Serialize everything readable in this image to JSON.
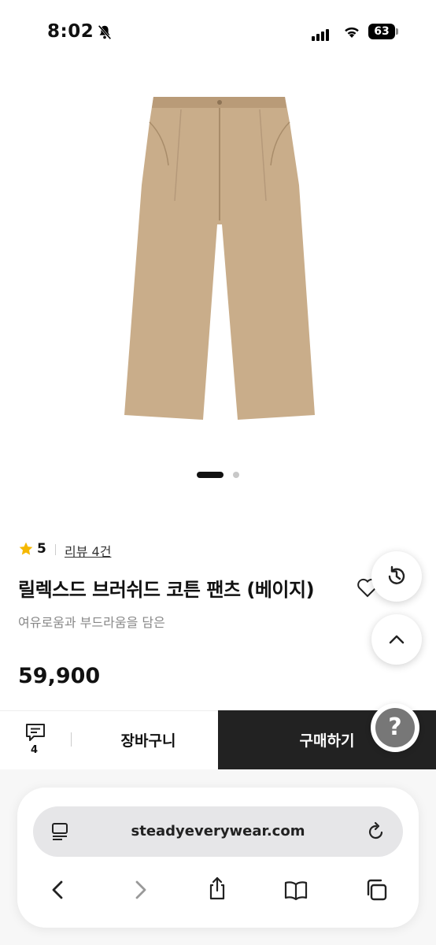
{
  "status_bar": {
    "time": "8:02",
    "battery": "63"
  },
  "product": {
    "rating": "5",
    "review_link": "리뷰 4건",
    "title": "릴렉스드 브러쉬드 코튼 팬츠 (베이지)",
    "subtitle": "여유로움과 부드라움을 담은",
    "price": "59,900",
    "image_color": "#c9ad8a"
  },
  "buy_bar": {
    "chat_count": "4",
    "cart_label": "장바구니",
    "buy_label": "구매하기"
  },
  "browser": {
    "url": "steadyeverywear.com"
  },
  "help_button": {
    "label": "?"
  },
  "icons": [
    "bell-off-icon",
    "wifi-icon",
    "star-icon",
    "heart-icon",
    "history-icon",
    "chevron-up-icon",
    "chat-icon",
    "reader-icon",
    "reload-icon",
    "back-icon",
    "forward-icon",
    "share-icon",
    "bookmarks-icon",
    "tabs-icon"
  ]
}
